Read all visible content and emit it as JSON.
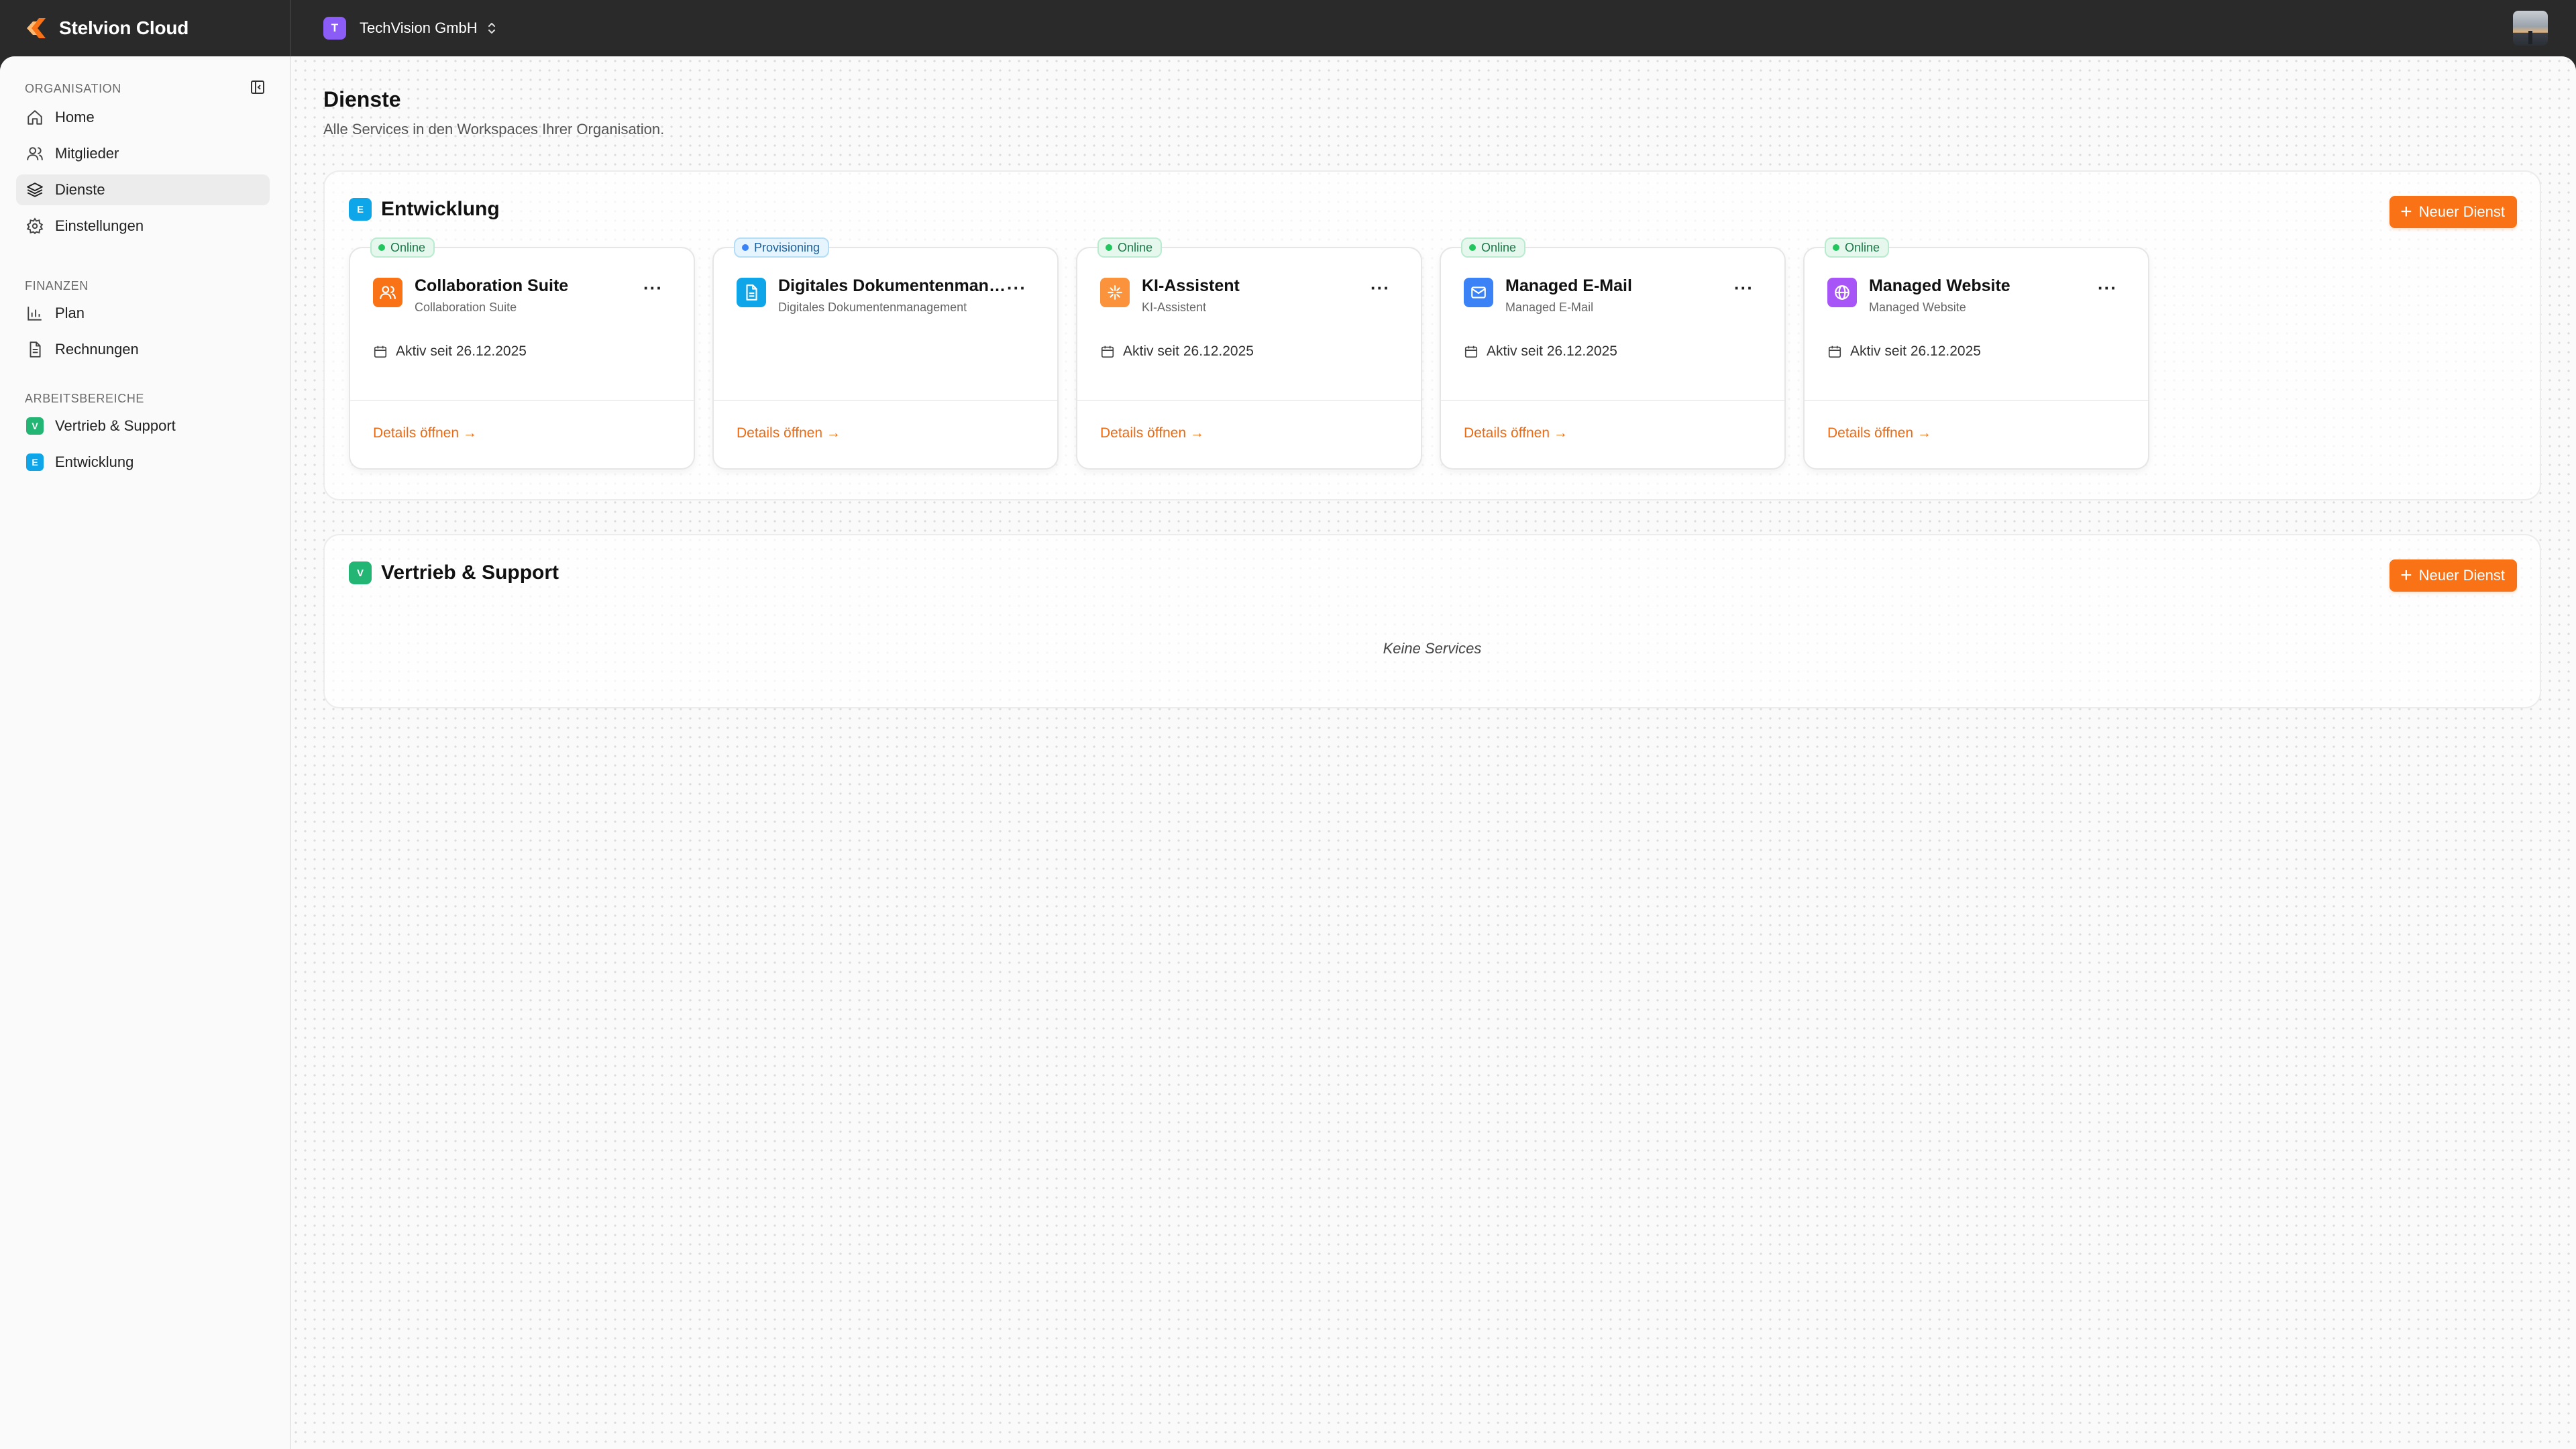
{
  "app": {
    "name": "Stelvion Cloud"
  },
  "org": {
    "badge": "T",
    "name": "TechVision GmbH",
    "badge_color": "#8b5cf6"
  },
  "sidebar": {
    "sections": {
      "organisation": "ORGANISATION",
      "finanzen": "FINANZEN",
      "arbeitsbereiche": "ARBEITSBEREICHE"
    },
    "org_items": [
      {
        "label": "Home",
        "icon": "home-icon"
      },
      {
        "label": "Mitglieder",
        "icon": "users-icon"
      },
      {
        "label": "Dienste",
        "icon": "layers-icon",
        "active": true
      },
      {
        "label": "Einstellungen",
        "icon": "gear-icon"
      }
    ],
    "finance_items": [
      {
        "label": "Plan",
        "icon": "bar-chart-icon"
      },
      {
        "label": "Rechnungen",
        "icon": "document-icon"
      }
    ],
    "workspaces": [
      {
        "badge": "V",
        "label": "Vertrieb & Support",
        "color": "#22b573"
      },
      {
        "badge": "E",
        "label": "Entwicklung",
        "color": "#0ea5e9"
      }
    ]
  },
  "page": {
    "title": "Dienste",
    "subtitle": "Alle Services in den Workspaces Ihrer Organisation."
  },
  "workspaces": [
    {
      "badge": "E",
      "title": "Entwicklung",
      "color": "#0ea5e9",
      "new_button": "Neuer Dienst",
      "services": [
        {
          "status": "Online",
          "name": "Collaboration Suite",
          "type": "Collaboration Suite",
          "since": "Aktiv seit 26.12.2025",
          "link": "Details öffnen →",
          "icon": "users-icon",
          "icon_color": "#f97316"
        },
        {
          "status": "Provisioning",
          "name": "Digitales Dokumentenmanagement",
          "type": "Digitales Dokumentenmanagement",
          "since": "",
          "link": "Details öffnen →",
          "icon": "file-icon",
          "icon_color": "#0ea5e9"
        },
        {
          "status": "Online",
          "name": "KI-Assistent",
          "type": "KI-Assistent",
          "since": "Aktiv seit 26.12.2025",
          "link": "Details öffnen →",
          "icon": "sparkle-icon",
          "icon_color": "#fb923c"
        },
        {
          "status": "Online",
          "name": "Managed E-Mail",
          "type": "Managed E-Mail",
          "since": "Aktiv seit 26.12.2025",
          "link": "Details öffnen →",
          "icon": "mail-icon",
          "icon_color": "#3b82f6"
        },
        {
          "status": "Online",
          "name": "Managed Website",
          "type": "Managed Website",
          "since": "Aktiv seit 26.12.2025",
          "link": "Details öffnen →",
          "icon": "globe-icon",
          "icon_color": "#a855f7"
        }
      ]
    },
    {
      "badge": "V",
      "title": "Vertrieb & Support",
      "color": "#22b573",
      "new_button": "Neuer Dienst",
      "empty_text": "Keine Services"
    }
  ],
  "colors": {
    "accent": "#f97316",
    "online": "#22c55e",
    "provisioning": "#3b82f6"
  }
}
